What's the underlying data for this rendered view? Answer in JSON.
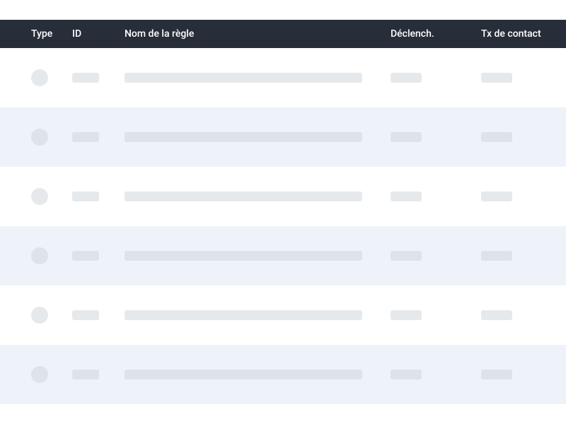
{
  "table": {
    "headers": {
      "type": "Type",
      "id": "ID",
      "name": "Nom de la règle",
      "trigger": "Déclench.",
      "contact": "Tx de contact"
    },
    "rows": [
      {
        "alt": false
      },
      {
        "alt": true
      },
      {
        "alt": false
      },
      {
        "alt": true
      },
      {
        "alt": false
      },
      {
        "alt": true
      }
    ]
  }
}
